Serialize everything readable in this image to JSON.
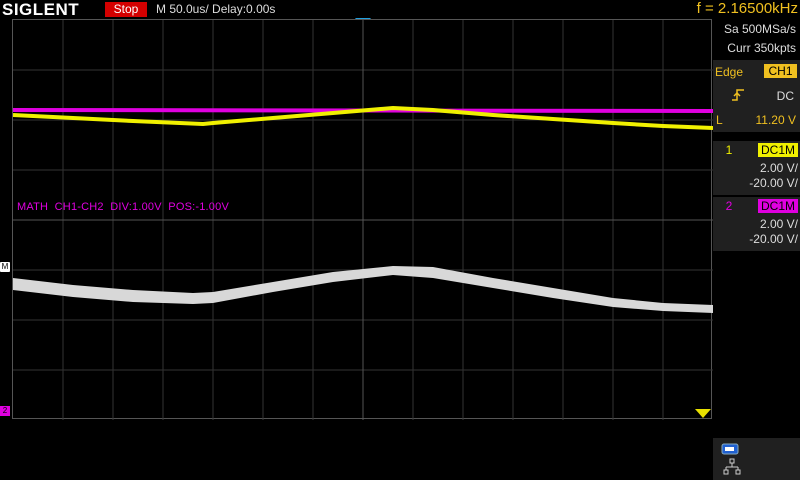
{
  "header": {
    "brand": "SIGLENT",
    "run_state": "Stop",
    "timebase": "M 50.0us/",
    "delay": "Delay:0.00s",
    "frequency": "f = 2.16500kHz"
  },
  "acquisition": {
    "sample_rate": "Sa 500MSa/s",
    "memory": "Curr 350kpts"
  },
  "trigger": {
    "type": "Edge",
    "source": "CH1",
    "coupling": "DC",
    "level_label": "L",
    "level": "11.20 V",
    "slope_icon": "rising-edge-icon"
  },
  "channels": [
    {
      "num": "1",
      "coupling": "DC1M",
      "scale": "2.00 V/",
      "offset": "-20.00 V/",
      "color": "#f0f000"
    },
    {
      "num": "2",
      "coupling": "DC1M",
      "scale": "2.00 V/",
      "offset": "-20.00 V/",
      "color": "#e000e0"
    }
  ],
  "math": {
    "label": "MATH  CH1-CH2  DIV:1.00V  POS:-1.00V",
    "marker": "M",
    "color": "#e000e0"
  },
  "markers": {
    "ch2": "2"
  },
  "colors": {
    "ch1": "#f0f000",
    "ch2": "#e000e0",
    "math": "#e0e0e0",
    "grid": "#555555",
    "trigger_accent": "#f0c020"
  }
}
